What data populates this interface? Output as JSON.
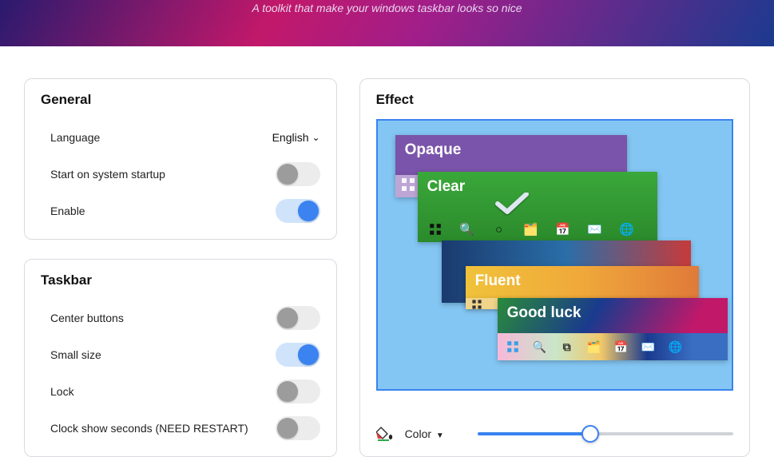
{
  "banner": {
    "subtitle": "A toolkit that make your windows taskbar looks so nice"
  },
  "general": {
    "title": "General",
    "language_label": "Language",
    "language_value": "English",
    "startup_label": "Start on system startup",
    "startup_on": false,
    "enable_label": "Enable",
    "enable_on": true
  },
  "taskbar": {
    "title": "Taskbar",
    "center_label": "Center buttons",
    "center_on": false,
    "small_label": "Small size",
    "small_on": true,
    "lock_label": "Lock",
    "lock_on": false,
    "clock_label": "Clock show seconds (NEED RESTART)",
    "clock_on": false
  },
  "effect": {
    "title": "Effect",
    "options": {
      "opaque": "Opaque",
      "clear": "Clear",
      "fluent": "Fluent",
      "goodluck": "Good luck"
    },
    "selected": "clear",
    "color_label": "Color",
    "color_slider": 44
  }
}
